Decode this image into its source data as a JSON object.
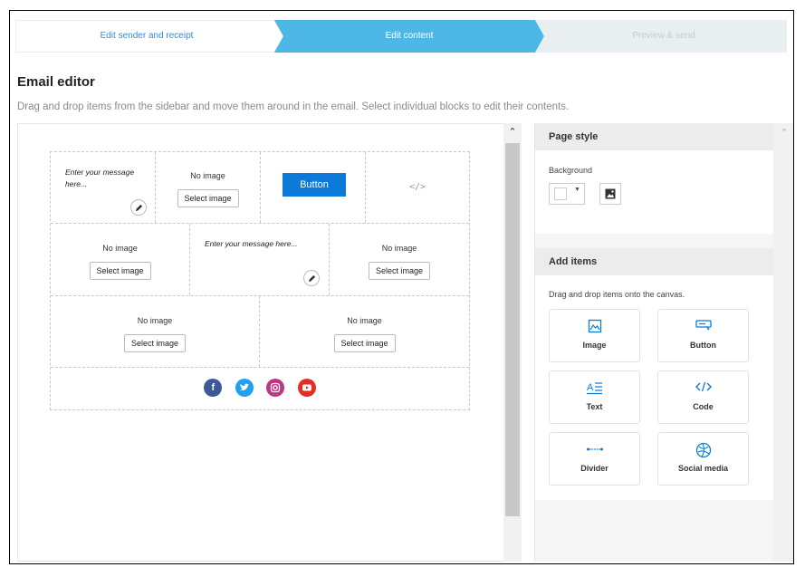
{
  "stepper": {
    "steps": [
      {
        "label": "Edit sender and receipt",
        "state": "done"
      },
      {
        "label": "Edit content",
        "state": "active"
      },
      {
        "label": "Preview & send",
        "state": "pending"
      }
    ],
    "colors": {
      "done": "#ffffff",
      "active": "#4db8e8",
      "pending": "#e9eef1"
    }
  },
  "editor": {
    "title": "Email editor",
    "description": "Drag and drop items from the sidebar and move them around in the email. Select individual blocks to edit their contents."
  },
  "email": {
    "no_image": "No image",
    "select_image": "Select image",
    "message_placeholder_short": "Enter your message here...",
    "message_placeholder_long": "Enter your message here...",
    "button_label": "Button",
    "code_glyph": "</>",
    "social_icons": [
      "facebook-icon",
      "twitter-icon",
      "instagram-icon",
      "youtube-icon"
    ],
    "social_colors": {
      "facebook": "#3b5998",
      "twitter": "#1da1f2",
      "instagram": "#c13584",
      "youtube": "#e52d27"
    }
  },
  "sidebar": {
    "page_style": {
      "title": "Page style",
      "background_label": "Background"
    },
    "add_items": {
      "title": "Add items",
      "hint": "Drag and drop items onto the canvas.",
      "items": [
        {
          "label": "Image",
          "icon": "image-icon"
        },
        {
          "label": "Button",
          "icon": "button-icon"
        },
        {
          "label": "Text",
          "icon": "text-icon"
        },
        {
          "label": "Code",
          "icon": "code-icon"
        },
        {
          "label": "Divider",
          "icon": "divider-icon"
        },
        {
          "label": "Social media",
          "icon": "social-media-icon"
        }
      ]
    }
  }
}
